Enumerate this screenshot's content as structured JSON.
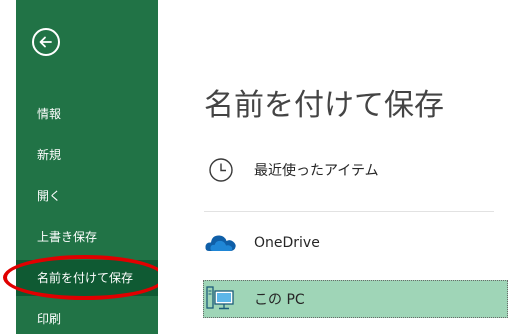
{
  "sidebar": {
    "back_icon": "back-arrow-icon",
    "items": [
      {
        "label": "情報"
      },
      {
        "label": "新規"
      },
      {
        "label": "開く"
      },
      {
        "label": "上書き保存"
      },
      {
        "label": "名前を付けて保存"
      },
      {
        "label": "印刷"
      }
    ],
    "selected_index": 4,
    "background": "#217346",
    "selected_background": "#0f5a33",
    "highlight_oval_color": "#e00000"
  },
  "main": {
    "title": "名前を付けて保存",
    "locations": [
      {
        "label": "最近使ったアイテム",
        "icon": "clock-icon"
      },
      {
        "label": "OneDrive",
        "icon": "cloud-icon"
      },
      {
        "label": "この PC",
        "icon": "computer-icon"
      }
    ],
    "selected_location_index": 2,
    "selected_background": "#9fd5b7"
  }
}
